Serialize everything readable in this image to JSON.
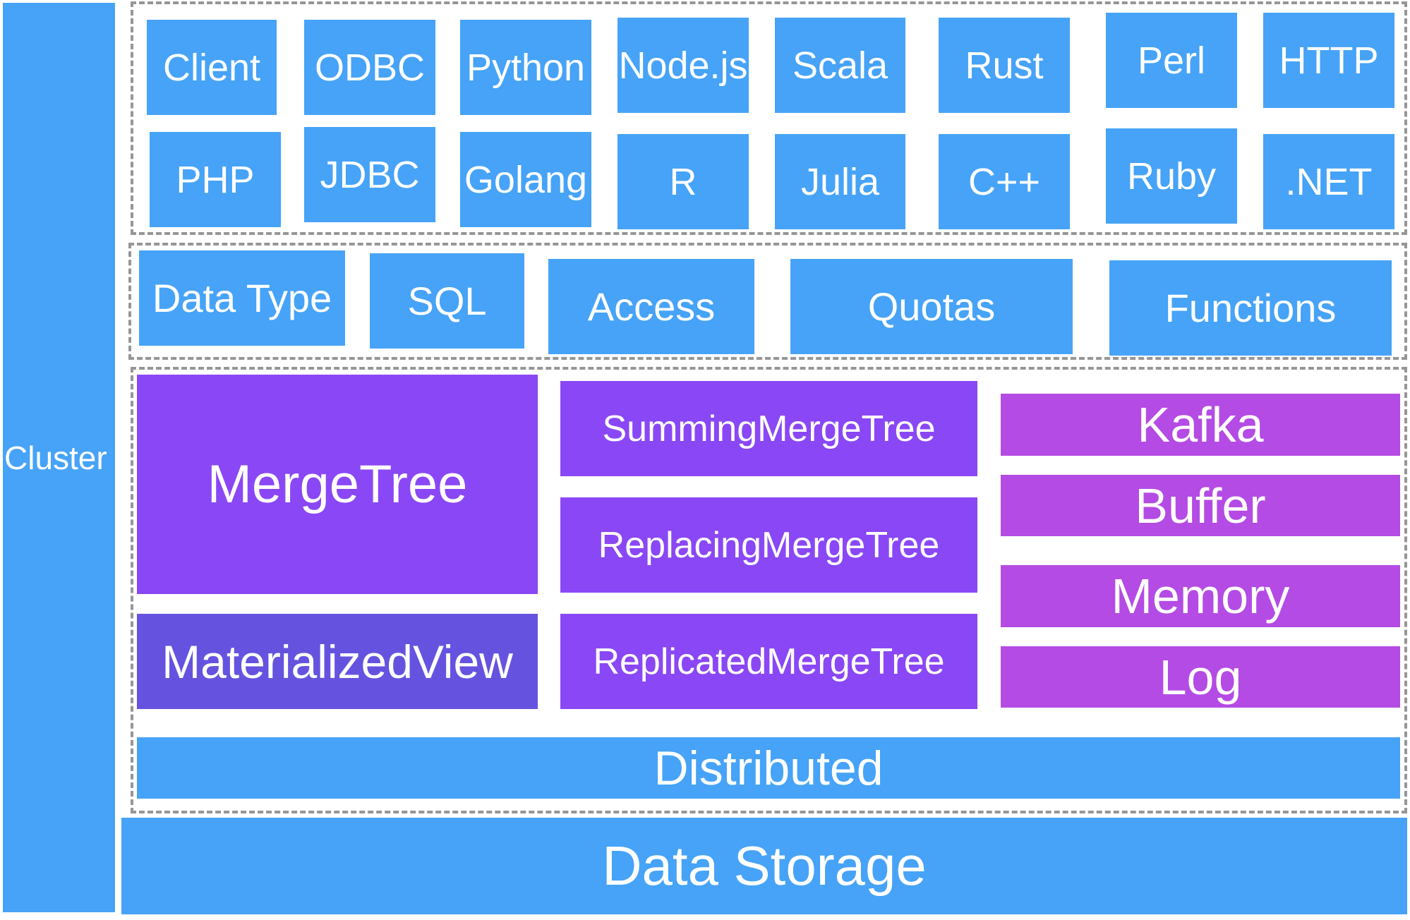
{
  "cluster": {
    "label": "Cluster"
  },
  "clients": {
    "row1": [
      "Client",
      "ODBC",
      "Python",
      "Node.js",
      "Scala",
      "Rust",
      "Perl",
      "HTTP"
    ],
    "row2": [
      "PHP",
      "JDBC",
      "Golang",
      "R",
      "Julia",
      "C++",
      "Ruby",
      ".NET"
    ]
  },
  "features": [
    "Data Type",
    "SQL",
    "Access",
    "Quotas",
    "Functions"
  ],
  "engines": {
    "mergetree": "MergeTree",
    "materialized_view": "MaterializedView",
    "merge_family": [
      "SummingMergeTree",
      "ReplacingMergeTree",
      "ReplicatedMergeTree"
    ],
    "other": [
      "Kafka",
      "Buffer",
      "Memory",
      "Log"
    ],
    "distributed": "Distributed"
  },
  "storage": {
    "label": "Data Storage"
  },
  "colors": {
    "blue": "#46a3f7",
    "purple": "#8a47f5",
    "materialized_view": "#6553e0",
    "magenta": "#b44be4",
    "dashed_border": "#969696"
  }
}
